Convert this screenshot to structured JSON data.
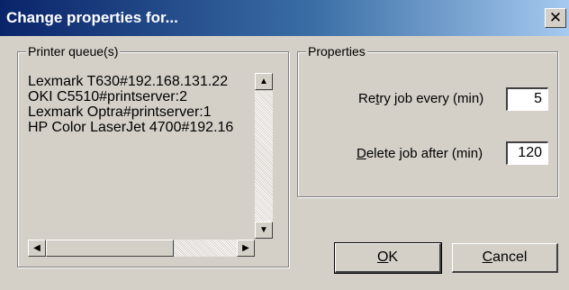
{
  "window": {
    "title": "Change properties for...",
    "close_glyph": "✕"
  },
  "printer_queues": {
    "label": "Printer queue(s)",
    "items": [
      "Lexmark T630#192.168.131.22",
      "OKI C5510#printserver:2",
      "Lexmark  Optra#printserver:1",
      "HP Color LaserJet 4700#192.16"
    ],
    "scroll_up_glyph": "▲",
    "scroll_down_glyph": "▼",
    "scroll_left_glyph": "◀",
    "scroll_right_glyph": "▶"
  },
  "properties": {
    "label": "Properties",
    "retry": {
      "label_pre": "Re",
      "label_accel": "t",
      "label_post": "ry job every (min)",
      "value": "5"
    },
    "delete": {
      "label_pre": "",
      "label_accel": "D",
      "label_post": "elete job after (min)",
      "value": "120"
    }
  },
  "buttons": {
    "ok": {
      "accel": "O",
      "rest": "K"
    },
    "cancel": {
      "accel": "C",
      "rest": "ancel"
    }
  }
}
